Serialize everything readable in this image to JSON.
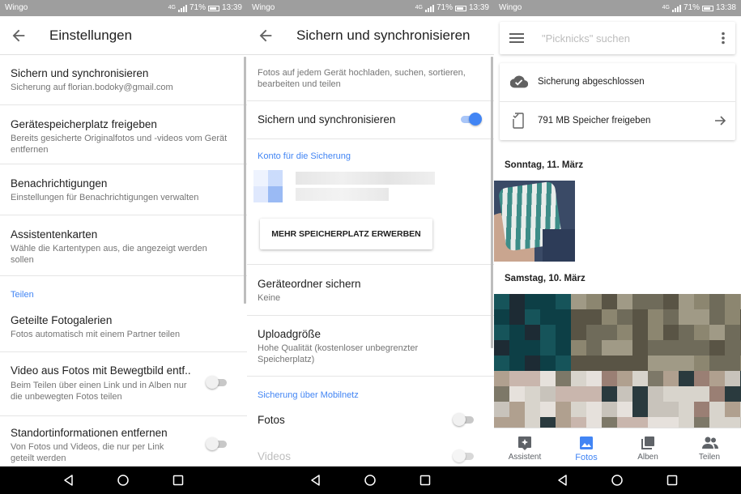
{
  "status": {
    "carrier": "Wingo",
    "battery": "71%",
    "time_left": "13:39",
    "time_mid": "13:39",
    "time_right": "13:38",
    "network": "4G"
  },
  "settings": {
    "title": "Einstellungen",
    "items": [
      {
        "title": "Sichern und synchronisieren",
        "subtitle": "Sicherung auf florian.bodoky@gmail.com"
      },
      {
        "title": "Gerätespeicherplatz freigeben",
        "subtitle": "Bereits gesicherte Originalfotos und -videos vom Gerät entfernen"
      },
      {
        "title": "Benachrichtigungen",
        "subtitle": "Einstellungen für Benachrichtigungen verwalten"
      },
      {
        "title": "Assistentenkarten",
        "subtitle": "Wähle die Kartentypen aus, die angezeigt werden sollen"
      }
    ],
    "section_share": "Teilen",
    "share_items": [
      {
        "title": "Geteilte Fotogalerien",
        "subtitle": "Fotos automatisch mit einem Partner teilen"
      },
      {
        "title": "Video aus Fotos mit Bewegtbild entf..",
        "subtitle": "Beim Teilen über einen Link und in Alben nur die unbewegten Fotos teilen"
      },
      {
        "title": "Standortinformationen entfernen",
        "subtitle": "Von Fotos und Videos, die nur per Link geteilt werden"
      }
    ]
  },
  "backup": {
    "title": "Sichern und synchronisieren",
    "intro": "Fotos auf jedem Gerät hochladen, suchen, sortieren, bearbeiten und teilen",
    "toggle_label": "Sichern und synchronisieren",
    "toggle_on": true,
    "section_account": "Konto für die Sicherung",
    "buy_button": "MEHR SPEICHERPLATZ ERWERBEN",
    "folders_title": "Geräteordner sichern",
    "folders_value": "Keine",
    "upload_title": "Uploadgröße",
    "upload_value": "Hohe Qualität (kostenloser unbegrenzter Speicherplatz)",
    "section_mobile": "Sicherung über Mobilnetz",
    "photos_label": "Fotos",
    "videos_label": "Videos"
  },
  "photos": {
    "search_placeholder": "\"Picknicks\" suchen",
    "backup_done": "Sicherung abgeschlossen",
    "free_space": "791 MB Speicher freigeben",
    "date1": "Sonntag, 11. März",
    "date2": "Samstag, 10. März",
    "nav": [
      {
        "label": "Assistent",
        "icon": "assistant-icon"
      },
      {
        "label": "Fotos",
        "icon": "photos-icon",
        "active": true
      },
      {
        "label": "Alben",
        "icon": "albums-icon"
      },
      {
        "label": "Teilen",
        "icon": "sharing-icon"
      }
    ]
  },
  "colors": {
    "accent": "#4285f4",
    "statusbar": "#9e9e9e",
    "text": "#212121",
    "secondary": "#757575"
  }
}
